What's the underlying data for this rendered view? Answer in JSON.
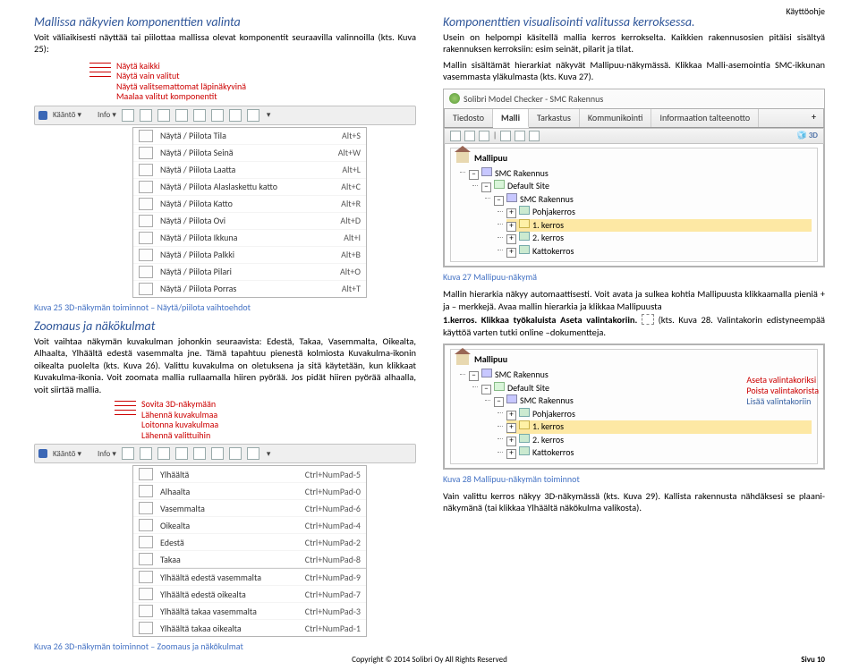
{
  "header": {
    "topright": "Käyttöohje"
  },
  "left": {
    "h1a": "Mallissa näkyvien komponenttien valinta",
    "p1": "Voit väliaikisesti näyttää tai piilottaa mallissa olevat komponentit seuraavilla valinnoilla (kts. Kuva 25):",
    "redlist": [
      "Näytä kaikki",
      "Näytä vain valitut",
      "Näytä valitsemattomat läpinäkyvinä",
      "Maalaa valitut komponentit"
    ],
    "toolbar1_labels": {
      "kaanto": "Kääntö ▾",
      "info": "Info ▾"
    },
    "menu25": [
      {
        "label": "Näytä / Piilota Tila",
        "kb": "Alt+S"
      },
      {
        "label": "Näytä / Piilota Seinä",
        "kb": "Alt+W"
      },
      {
        "label": "Näytä / Piilota Laatta",
        "kb": "Alt+L"
      },
      {
        "label": "Näytä / Piilota Alaslaskettu katto",
        "kb": "Alt+C"
      },
      {
        "label": "Näytä / Piilota Katto",
        "kb": "Alt+R"
      },
      {
        "label": "Näytä / Piilota Ovi",
        "kb": "Alt+D"
      },
      {
        "label": "Näytä / Piilota Ikkuna",
        "kb": "Alt+I"
      },
      {
        "label": "Näytä / Piilota Palkki",
        "kb": "Alt+B"
      },
      {
        "label": "Näytä / Piilota Pilari",
        "kb": "Alt+O"
      },
      {
        "label": "Näytä / Piilota Porras",
        "kb": "Alt+T"
      }
    ],
    "caption25": "Kuva 25 3D-näkymän toiminnot – Näytä/piilota vaihtoehdot",
    "h1b": "Zoomaus ja näkökulmat",
    "p2": "Voit vaihtaa näkymän kuvakulman johonkin seuraavista: Edestä, Takaa, Vasemmalta, Oikealta, Alhaalta, Ylhäältä edestä vasemmalta jne. Tämä tapahtuu pienestä kolmiosta Kuvakulma-ikonin oikealta puolelta (kts. Kuva 26). Valittu kuvakulma on oletuksena ja sitä käytetään, kun klikkaat Kuvakulma-ikonia. Voit zoomata mallia rullaamalla hiiren pyörää. Jos pidät hiiren pyörää alhaalla, voit siirtää mallia.",
    "redlist2": [
      "Sovita 3D-näkymään",
      "Lähennä kuvakulmaa",
      "Loitonna kuvakulmaa",
      "Lähennä valittuihin"
    ],
    "menu26_top": [
      {
        "label": "Ylhäältä",
        "kb": "Ctrl+NumPad-5"
      },
      {
        "label": "Alhaalta",
        "kb": "Ctrl+NumPad-0"
      },
      {
        "label": "Vasemmalta",
        "kb": "Ctrl+NumPad-6"
      },
      {
        "label": "Oikealta",
        "kb": "Ctrl+NumPad-4"
      },
      {
        "label": "Edestä",
        "kb": "Ctrl+NumPad-2"
      },
      {
        "label": "Takaa",
        "kb": "Ctrl+NumPad-8"
      }
    ],
    "menu26_bot": [
      {
        "label": "Ylhäältä edestä vasemmalta",
        "kb": "Ctrl+NumPad-9"
      },
      {
        "label": "Ylhäältä edestä oikealta",
        "kb": "Ctrl+NumPad-7"
      },
      {
        "label": "Ylhäältä takaa vasemmalta",
        "kb": "Ctrl+NumPad-3"
      },
      {
        "label": "Ylhäältä takaa oikealta",
        "kb": "Ctrl+NumPad-1"
      }
    ],
    "caption26": "Kuva 26 3D-näkymän toiminnot – Zoomaus ja näkökulmat"
  },
  "right": {
    "h1c": "Komponenttien visualisointi valitussa kerroksessa.",
    "p3": "Usein on helpompi käsitellä mallia kerros kerrokselta. Kaikkien rakennusosien pitäisi sisältyä rakennuksen kerroksiin: esim seinät, pilarit ja tilat.",
    "p4": "Mallin sisältämät hierarkiat näkyvät Mallipuu-näkymässä. Klikkaa Malli-asemointia SMC-ikkunan vasemmasta yläkulmasta (kts. Kuva 27).",
    "smc_title": "Solibri Model Checker - SMC Rakennus",
    "tabs": [
      "Tiedosto",
      "Malli",
      "Tarkastus",
      "Kommunikointi",
      "Informaation talteenotto"
    ],
    "ministrip": {
      "d3": "3D"
    },
    "pane_title": "Mallipuu",
    "tree": {
      "root": "SMC Rakennus",
      "site": "Default Site",
      "building": "SMC Rakennus",
      "floors": [
        "Pohjakerros",
        "1. kerros",
        "2. kerros",
        "Kattokerros"
      ],
      "selected": 1
    },
    "caption27": "Kuva 27 Mallipuu-näkymä",
    "p5": "Mallin hierarkia näkyy automaattisesti. Voit avata ja sulkea kohtia Mallipuusta klikkaamalla pieniä + ja – merkkejä. Avaa mallin hierarkia ja klikkaa Mallipuusta",
    "p6a": "1.kerros. Klikkaa työkaluista Aseta valintakoriin.",
    "p6b": " (kts. Kuva 28. Valintakorin edistyneempää käyttöä varten tutki online –dokumentteja.",
    "ctxt_menu": [
      "Aseta valintakoriksi",
      "Poista valintakorista",
      "Lisää valintakoriin"
    ],
    "caption28": "Kuva 28 Mallipuu-näkymän toiminnot",
    "p7": "Vain valittu kerros näkyy 3D-näkymässä (kts. Kuva 29). Kallista rakennusta nähdäksesi se plaani-näkymänä (tai klikkaa Ylhäältä näkökulma valikosta)."
  },
  "footer": {
    "copyright": "Copyright © 2014 Solibri Oy All Rights Reserved",
    "page": "Sivu 10"
  }
}
